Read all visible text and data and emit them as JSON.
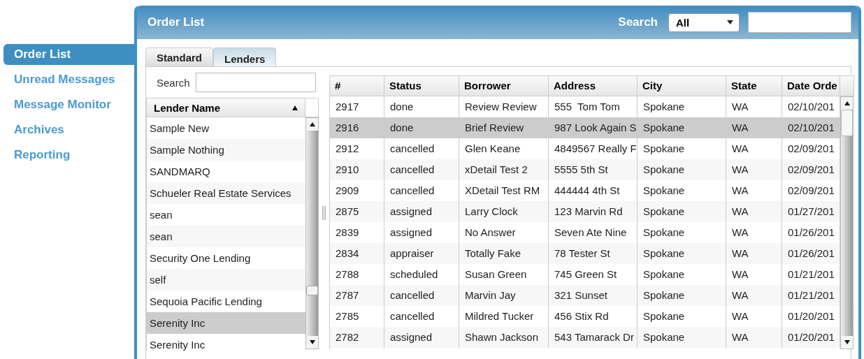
{
  "sidebar": {
    "items": [
      {
        "label": "Order List",
        "selected": true
      },
      {
        "label": "Unread Messages",
        "selected": false
      },
      {
        "label": "Message Monitor",
        "selected": false
      },
      {
        "label": "Archives",
        "selected": false
      },
      {
        "label": "Reporting",
        "selected": false
      }
    ]
  },
  "panel": {
    "title": "Order List",
    "search_label": "Search",
    "search_scope": "All"
  },
  "tabs": [
    {
      "label": "Standard",
      "selected": false
    },
    {
      "label": "Lenders",
      "selected": true
    }
  ],
  "lenders": {
    "search_label": "Search",
    "column": "Lender Name",
    "rows": [
      {
        "name": "Sample New",
        "selected": false
      },
      {
        "name": "Sample Nothing",
        "selected": false
      },
      {
        "name": "SANDMARQ",
        "selected": false
      },
      {
        "name": "Schueler Real Estate Services",
        "selected": false
      },
      {
        "name": "sean",
        "selected": false
      },
      {
        "name": "sean",
        "selected": false
      },
      {
        "name": "Security One Lending",
        "selected": false
      },
      {
        "name": "self",
        "selected": false
      },
      {
        "name": "Sequoia Pacific Lending",
        "selected": false
      },
      {
        "name": "Serenity Inc",
        "selected": true
      },
      {
        "name": "Serenity Inc",
        "selected": false
      }
    ]
  },
  "table": {
    "columns": [
      "#",
      "Status",
      "Borrower",
      "Address",
      "City",
      "State",
      "Date Orde"
    ],
    "rows": [
      {
        "cells": [
          "2917",
          "done",
          "Review Review",
          "555  Tom Tom",
          "Spokane",
          "WA",
          "02/10/201"
        ],
        "selected": false
      },
      {
        "cells": [
          "2916",
          "done",
          "Brief Review",
          "987 Look Again S",
          "Spokane",
          "WA",
          "02/10/201"
        ],
        "selected": true
      },
      {
        "cells": [
          "2912",
          "cancelled",
          "Glen Keane",
          "4849567 Really F",
          "Spokane",
          "WA",
          "02/09/201"
        ],
        "selected": false
      },
      {
        "cells": [
          "2910",
          "cancelled",
          "xDetail Test 2",
          "5555 5th St",
          "Spokane",
          "WA",
          "02/09/201"
        ],
        "selected": false
      },
      {
        "cells": [
          "2909",
          "cancelled",
          "XDetail Test RM",
          "444444 4th St",
          "Spokane",
          "WA",
          "02/09/201"
        ],
        "selected": false
      },
      {
        "cells": [
          "2875",
          "assigned",
          "Larry Clock",
          "123 Marvin Rd",
          "Spokane",
          "WA",
          "01/27/201"
        ],
        "selected": false
      },
      {
        "cells": [
          "2839",
          "assigned",
          "No Answer",
          "Seven Ate Nine",
          "Spokane",
          "WA",
          "01/26/201"
        ],
        "selected": false
      },
      {
        "cells": [
          "2834",
          "appraiser",
          "Totally Fake",
          "78 Tester St",
          "Spokane",
          "WA",
          "01/26/201"
        ],
        "selected": false
      },
      {
        "cells": [
          "2788",
          "scheduled",
          "Susan Green",
          "745 Green St",
          "Spokane",
          "WA",
          "01/21/201"
        ],
        "selected": false
      },
      {
        "cells": [
          "2787",
          "cancelled",
          "Marvin Jay",
          "321 Sunset",
          "Spokane",
          "WA",
          "01/21/201"
        ],
        "selected": false
      },
      {
        "cells": [
          "2785",
          "cancelled",
          "Mildred Tucker",
          "456 Stix Rd",
          "Spokane",
          "WA",
          "01/20/201"
        ],
        "selected": false
      },
      {
        "cells": [
          "2782",
          "assigned",
          "Shawn Jackson",
          "543 Tamarack Dr",
          "Spokane",
          "WA",
          "01/20/201"
        ],
        "selected": false
      }
    ]
  }
}
